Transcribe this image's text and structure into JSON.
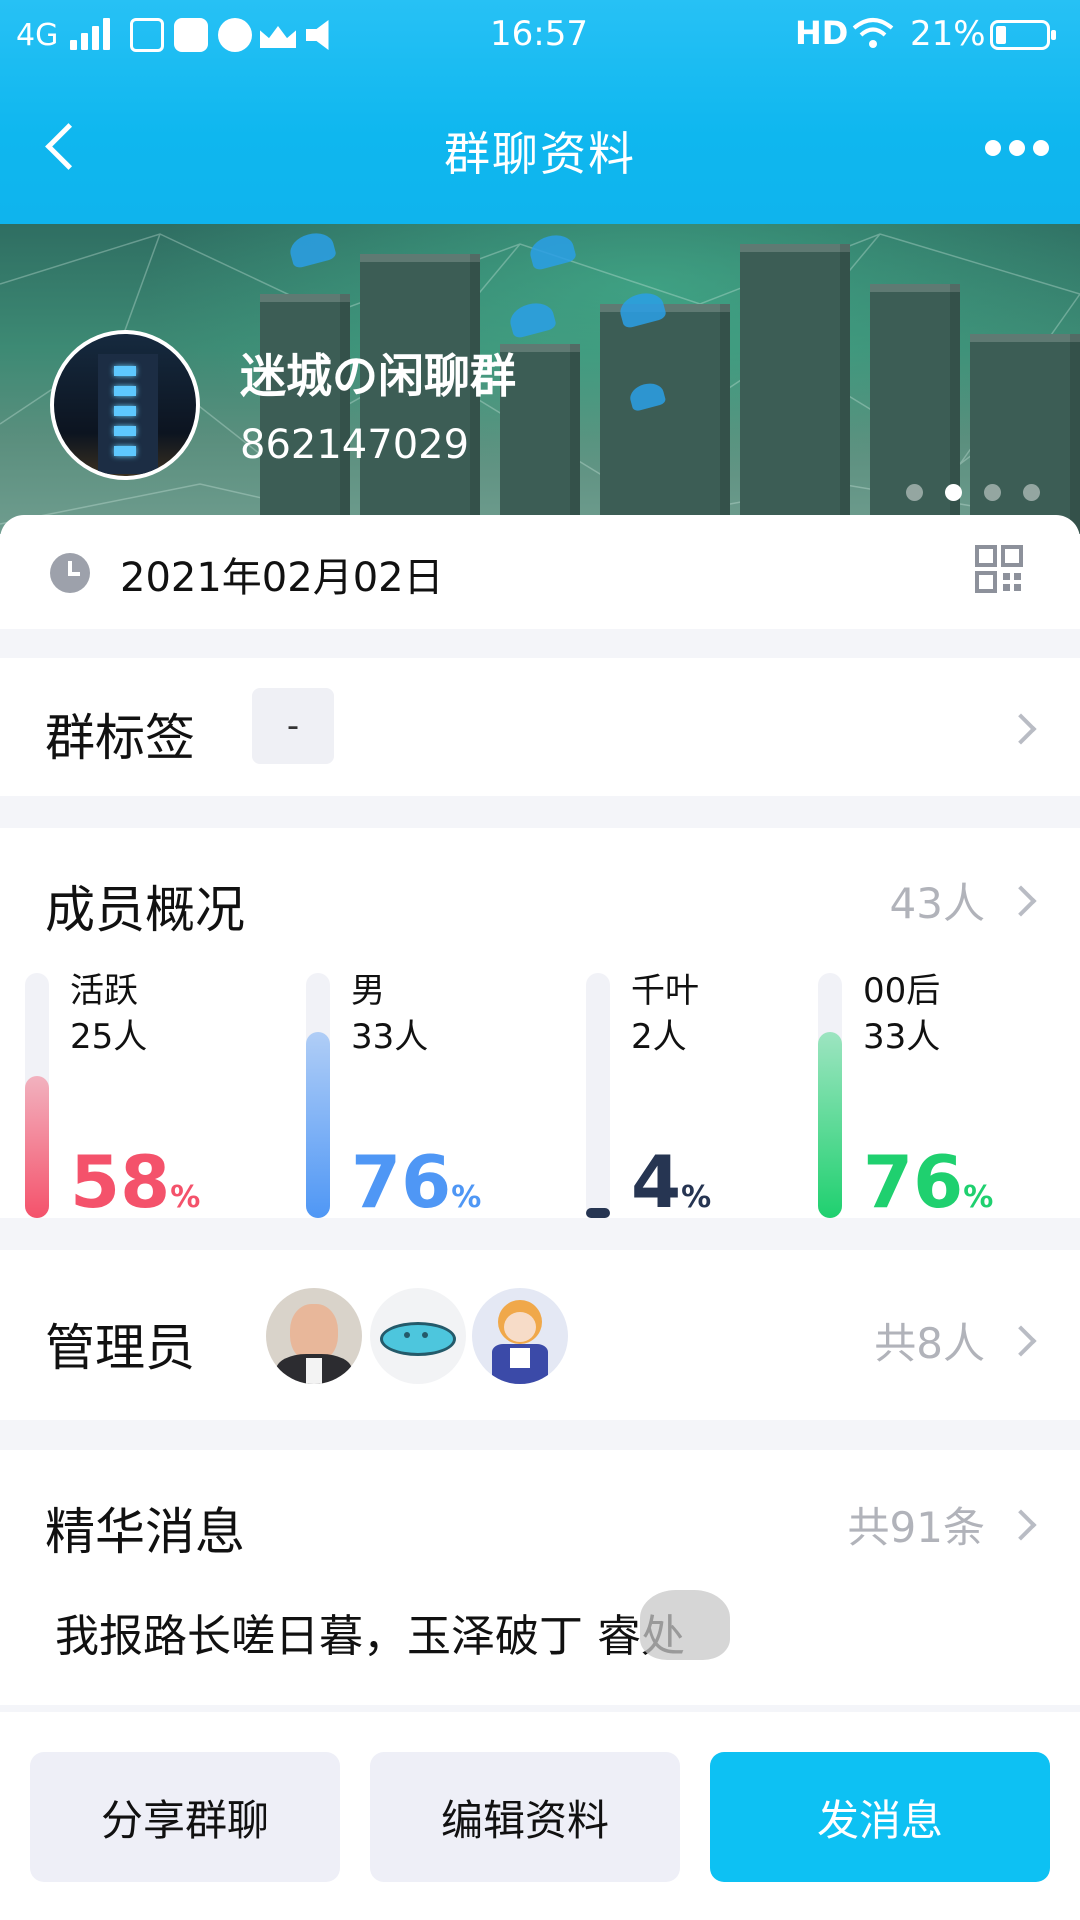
{
  "status_bar": {
    "network": "4G",
    "time": "16:57",
    "hd": "HD",
    "battery": "21%"
  },
  "header": {
    "title": "群聊资料"
  },
  "group": {
    "name": "迷城の闲聊群",
    "id": "862147029",
    "carousel_active_index": 1,
    "carousel_count": 4
  },
  "created_date": "2021年02月02日",
  "tags": {
    "label": "群标签",
    "value": "-"
  },
  "members": {
    "label": "成员概况",
    "total": "43人",
    "stats": [
      {
        "name": "活跃",
        "count": "25人",
        "percent": "58",
        "unit": "%",
        "color": "#f4526b",
        "fill": 0.58
      },
      {
        "name": "男",
        "count": "33人",
        "percent": "76",
        "unit": "%",
        "color": "#4f97f5",
        "fill": 0.76
      },
      {
        "name": "千叶",
        "count": "2人",
        "percent": "4",
        "unit": "%",
        "color": "#263552",
        "fill": 0.04
      },
      {
        "name": "00后",
        "count": "33人",
        "percent": "76",
        "unit": "%",
        "color": "#1fd06f",
        "fill": 0.76
      }
    ]
  },
  "admins": {
    "label": "管理员",
    "count": "共8人"
  },
  "digest": {
    "label": "精华消息",
    "count": "共91条",
    "preview": "我报路长嗟日暮，玉泽破丁 睿处"
  },
  "actions": {
    "share": "分享群聊",
    "edit": "编辑资料",
    "send": "发消息"
  },
  "colors": {
    "brand": "#12b8ef",
    "send_button": "#0dc1f3",
    "secondary_button": "#eeeff7"
  }
}
